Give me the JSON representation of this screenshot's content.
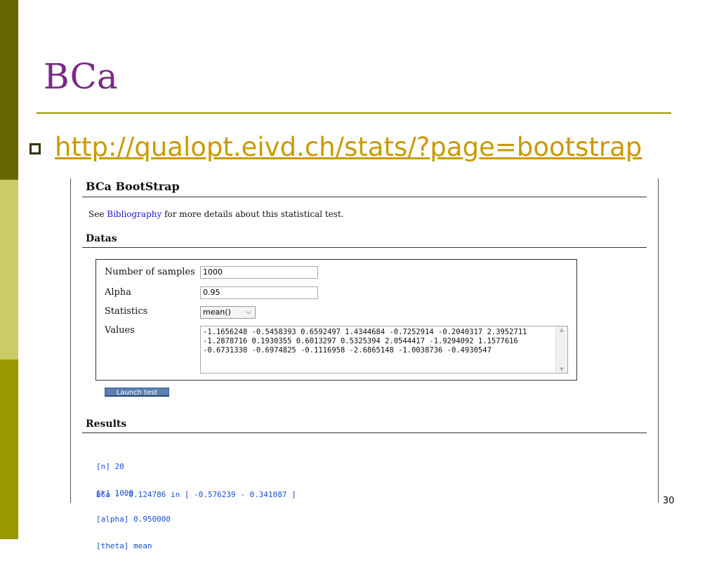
{
  "slide": {
    "title": "BCa",
    "link": "http://qualopt.eivd.ch/stats/?page=bootstrap",
    "page_number": "30"
  },
  "page": {
    "heading": "BCa BootStrap",
    "see_prefix": "See",
    "see_link": "Bibliography",
    "see_suffix": "for more details about this statistical test.",
    "datas_heading": "Datas",
    "results_heading": "Results"
  },
  "form": {
    "samples_label": "Number of samples",
    "samples_value": "1000",
    "alpha_label": "Alpha",
    "alpha_value": "0.95",
    "statistics_label": "Statistics",
    "statistics_value": "mean()",
    "values_label": "Values",
    "values_text": "-1.1656248 -0.5458393  0.6592497  1.4344684 -0.7252914 -0.2040317  2.3952711 -1.2878716  0.1930355  0.6013297  0.5325394  2.0544417 -1.9294092  1.1577616 -0.6731330 -0.6974825 -0.1116958 -2.6865148 -1.0038736 -0.4930547",
    "launch_label": "Launch test"
  },
  "results": {
    "lines": [
      "[n] 20",
      "[k] 1000",
      "[alpha] 0.950000",
      "[theta] mean"
    ],
    "bca": "BCa : -0.124786 in [ -0.576239 - 0.341087 ]"
  },
  "colors": {
    "title": "#7a2a86",
    "link": "#cc9900",
    "accent": "#999900",
    "result_text": "#1a4fcc"
  }
}
